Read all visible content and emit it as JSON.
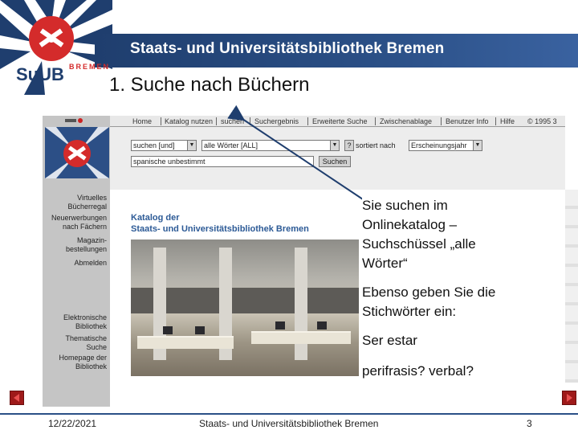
{
  "header": {
    "institution": "Staats- und Universitätsbibliothek Bremen",
    "logo_main": "SuUB",
    "logo_side": "BREMEN"
  },
  "slide_title": "1. Suche nach Büchern",
  "screenshot": {
    "tabs": [
      "Home",
      "Katalog nutzen",
      "suchen",
      "Suchergebnis",
      "Erweiterte Suche",
      "Zwischenablage",
      "Benutzer Info",
      "Hilfe",
      "© 1995 3"
    ],
    "search": {
      "operator": "suchen [und]",
      "index": "alle Wörter [ALL]",
      "help": "?",
      "sort_label": "sortiert nach",
      "sort_value": "Erscheinungsjahr",
      "query": "spanische unbestimmt",
      "submit": "Suchen"
    },
    "sidebar_top": [
      "Virtuelles Bücherregal",
      "Neuerwerbungen nach Fächern",
      "Magazin-bestellungen",
      "Abmelden"
    ],
    "sidebar_bottom": [
      "Elektronische Bibliothek",
      "Thematische Suche",
      "Homepage der Bibliothek"
    ],
    "catalog_title_1": "Katalog der",
    "catalog_title_2": "Staats- und Universitätsbibliothek Bremen"
  },
  "callouts": {
    "p1": "Sie suchen im Onlinekatalog – Suchschüssel „alle Wörter“",
    "p2": "Ebenso geben Sie die Stichwörter ein:",
    "p3": "Ser estar",
    "p4": "perifrasis? verbal?"
  },
  "footer": {
    "date": "12/22/2021",
    "center": "Staats- und Universitätsbibliothek Bremen",
    "page": "3"
  },
  "colors": {
    "brand_blue": "#2b5087",
    "brand_red": "#d42b2b"
  }
}
